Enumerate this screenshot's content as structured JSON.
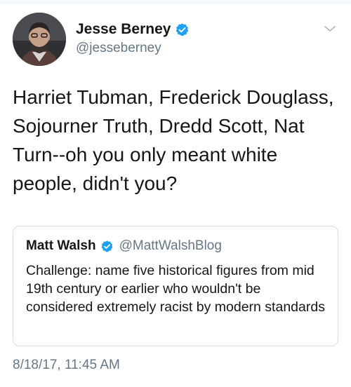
{
  "tweet": {
    "author": {
      "display_name": "Jesse Berney",
      "handle": "@jesseberney",
      "verified_icon": "verified-badge-icon"
    },
    "text": "Harriet Tubman, Frederick Douglass, Sojourner Truth, Dredd Scott, Nat Turn--oh you only meant white people, didn't you?",
    "timestamp": "8/18/17, 11:45 AM",
    "menu_icon": "chevron-down-icon"
  },
  "quoted_tweet": {
    "author": {
      "display_name": "Matt Walsh",
      "handle": "@MattWalshBlog",
      "verified_icon": "verified-badge-icon"
    },
    "text": "Challenge: name five historical figures from mid 19th century or earlier who wouldn't be considered extremely racist by modern standards"
  },
  "colors": {
    "text_primary": "#14171a",
    "text_secondary": "#657786",
    "verified_blue": "#1da1f2",
    "border": "#d7dde2"
  }
}
